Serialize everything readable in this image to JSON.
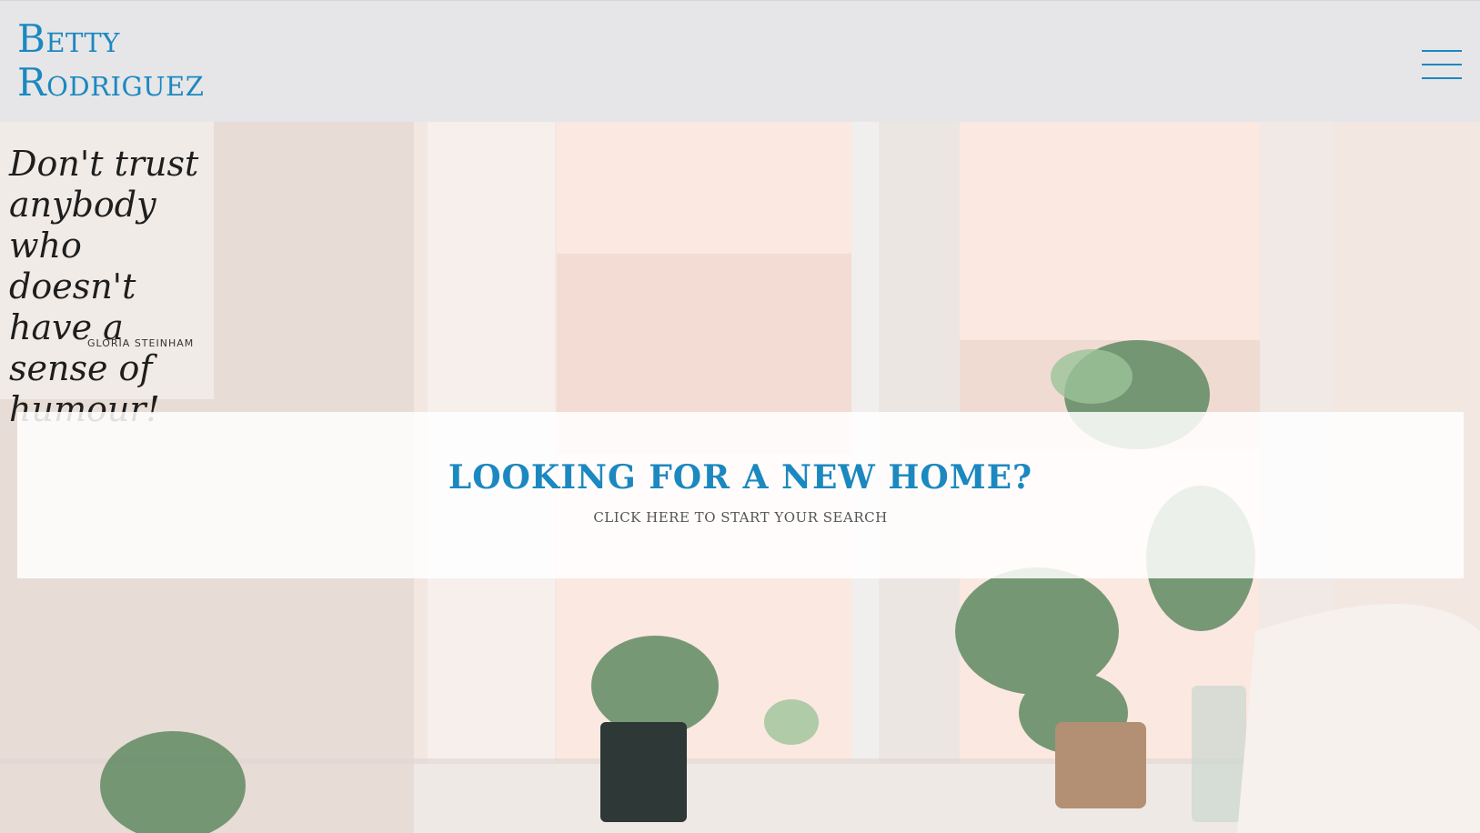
{
  "header": {
    "brand_line1": "Betty",
    "brand_line2": "Rodriguez",
    "menu_icon": "hamburger-menu-icon"
  },
  "hero": {
    "poster_quote": "Don't trust anybody who doesn't have a sense of humour!",
    "poster_author": "GLORIA STEINHAM",
    "cta_title": "LOOKING FOR A NEW HOME?",
    "cta_subtitle": "CLICK HERE TO START YOUR SEARCH"
  },
  "colors": {
    "accent": "#1c88c0",
    "header_bg": "#e6e6e8"
  }
}
